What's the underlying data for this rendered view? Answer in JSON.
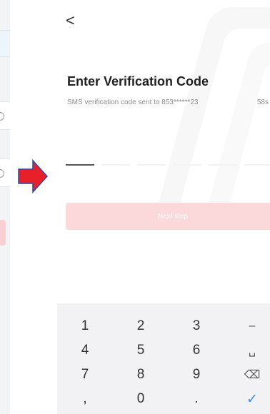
{
  "header": {
    "back_glyph": "<"
  },
  "verification": {
    "title": "Enter Verification Code",
    "sms_message": "SMS verification code sent to 853******23",
    "countdown": "58s",
    "code_slots": [
      "",
      "",
      "",
      "",
      "",
      ""
    ],
    "active_slot": 0,
    "next_button_label": "Next step"
  },
  "keyboard": {
    "rows": [
      [
        "1",
        "2",
        "3",
        "–"
      ],
      [
        "4",
        "5",
        "6",
        "␣"
      ],
      [
        "7",
        "8",
        "9",
        "⌫"
      ],
      [
        ",",
        "0",
        ".",
        "✓"
      ]
    ],
    "key_names": [
      [
        "key-1",
        "key-2",
        "key-3",
        "key-minus"
      ],
      [
        "key-4",
        "key-5",
        "key-6",
        "key-space"
      ],
      [
        "key-7",
        "key-8",
        "key-9",
        "key-backspace"
      ],
      [
        "key-comma",
        "key-0",
        "key-period",
        "key-done"
      ]
    ]
  },
  "colors": {
    "annotation_arrow": "#e8202a",
    "arrow_outline": "#2b4aa8",
    "next_button_disabled": "#fbd9db",
    "keyboard_bg": "#f2f2f4",
    "done_key": "#3d8ef0"
  },
  "icons": {
    "back": "chevron-left-icon",
    "arrow": "red-arrow-right-icon",
    "backspace": "backspace-icon",
    "space": "space-bar-icon",
    "done": "checkmark-icon"
  }
}
